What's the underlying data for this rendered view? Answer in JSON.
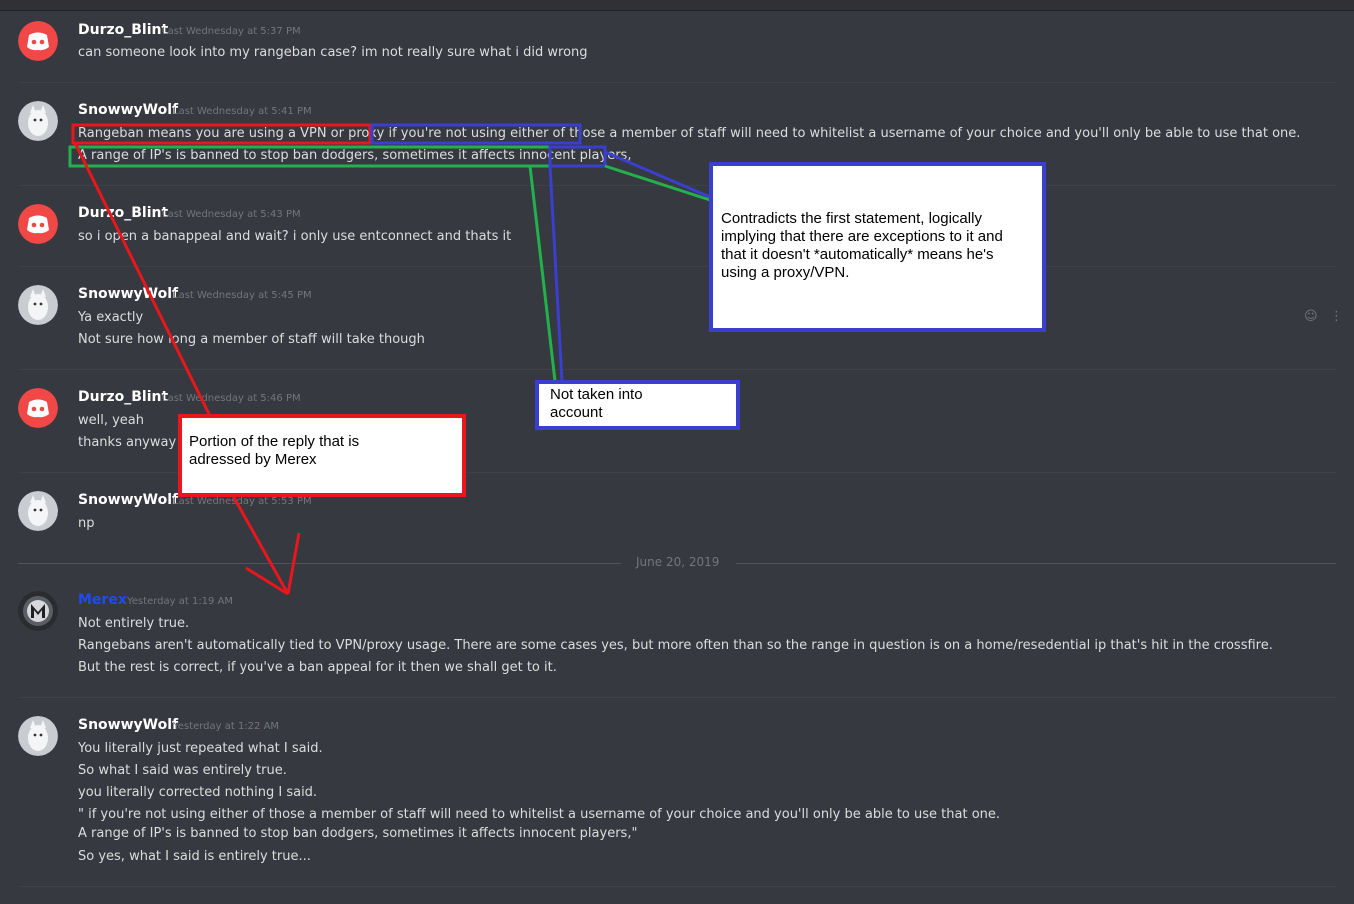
{
  "messages": [
    {
      "author": "Durzo_Blint",
      "timestamp": "Last Wednesday at 5:37 PM",
      "lines": [
        "can someone look into my rangeban case? im not really sure what i did wrong"
      ]
    },
    {
      "author": "SnowwyWolf",
      "timestamp": "Last Wednesday at 5:41 PM",
      "lines": [
        "Rangeban means you are using a VPN or proxy if you're not using either of those a member of staff will need to whitelist a username of your choice and you'll only be able to use that one.",
        "A range of IP's is banned to stop ban dodgers, sometimes it affects innocent players,"
      ]
    },
    {
      "author": "Durzo_Blint",
      "timestamp": "Last Wednesday at 5:43 PM",
      "lines": [
        "so i open a banappeal and wait? i only use entconnect and thats it"
      ]
    },
    {
      "author": "SnowwyWolf",
      "timestamp": "Last Wednesday at 5:45 PM",
      "lines": [
        "Ya exactly",
        "Not sure how long a member of staff will take though"
      ]
    },
    {
      "author": "Durzo_Blint",
      "timestamp": "Last Wednesday at 5:46 PM",
      "lines": [
        "well, yeah",
        "thanks anyway!"
      ]
    },
    {
      "author": "SnowwyWolf",
      "timestamp": "Last Wednesday at 5:53 PM",
      "lines": [
        "np"
      ]
    },
    {
      "author": "Merex",
      "timestamp": "Yesterday at 1:19 AM",
      "lines": [
        "Not entirely true.",
        "Rangebans aren't automatically tied to VPN/proxy usage. There are some cases yes, but more often than so the range in question is on a home/resedential ip that's hit in the crossfire.",
        "But the rest is correct, if you've a ban appeal for it then we shall get to it."
      ]
    },
    {
      "author": "SnowwyWolf",
      "timestamp": "Yesterday at 1:22 AM",
      "lines": [
        "You literally just repeated what I said.",
        "So what I said was entirely true.",
        "you literally corrected nothing I said.",
        "\" if you're not using either of those a member of staff will need to whitelist a username of your choice and you'll only be able to use that one.",
        "A range of IP's is banned to stop ban dodgers, sometimes it affects innocent players,\"",
        "So yes, what I said is entirely true..."
      ]
    }
  ],
  "date_separator": "June 20, 2019",
  "annotations": {
    "contradicts": [
      "Contradicts the first statement, logically",
      "implying that there are exceptions to it and",
      "that it doesn't *automatically* means he's",
      "using a proxy/VPN."
    ],
    "not_taken": [
      "Not taken into",
      "account"
    ],
    "portion": [
      "Portion of the reply that is",
      "adressed by Merex"
    ]
  },
  "colors": {
    "background": "#36393f",
    "author_default": "#ffffff",
    "author_merex": "#1f4bf2",
    "annot_red": "#e8161d",
    "annot_blue": "#3a3fcf",
    "annot_green": "#22b14c",
    "discord_red": "#f04747"
  },
  "icons": [
    "discord-logo-icon",
    "wolf-avatar-icon",
    "merex-avatar-icon",
    "add-reaction-icon",
    "more-options-icon"
  ]
}
